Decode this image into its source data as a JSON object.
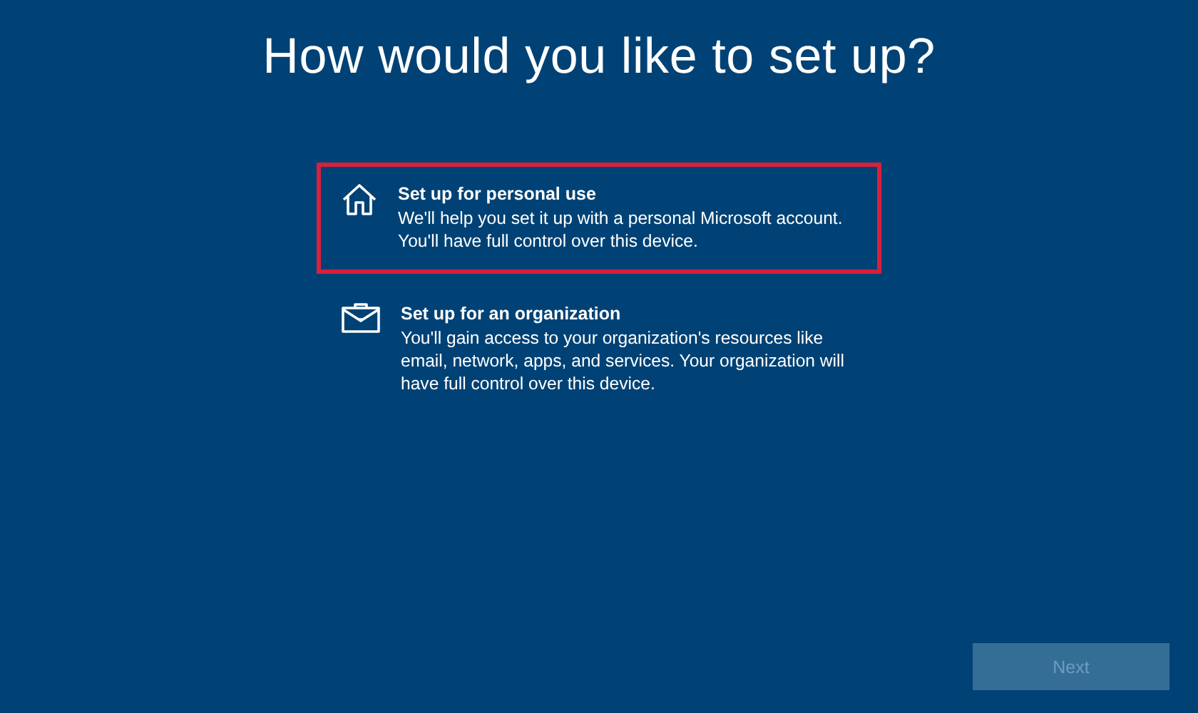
{
  "title": "How would you like to set up?",
  "options": [
    {
      "kind": "home",
      "title": "Set up for personal use",
      "description": "We'll help you set it up with a personal Microsoft account. You'll have full control over this device.",
      "selected": true
    },
    {
      "kind": "briefcase",
      "title": "Set up for an organization",
      "description": "You'll gain access to your organization's resources like email, network, apps, and services. Your organization will have full control over this device.",
      "selected": false
    }
  ],
  "next_button": {
    "label": "Next",
    "disabled": true
  }
}
